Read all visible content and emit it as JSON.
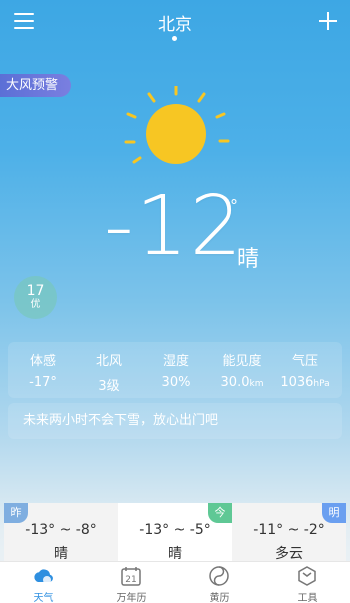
{
  "header": {
    "city": "北京"
  },
  "alert": {
    "label": "大风预警"
  },
  "current": {
    "temperature": "-12",
    "degree_symbol": "°",
    "condition": "晴",
    "aqi_value": "17",
    "aqi_level": "优"
  },
  "details": [
    {
      "label": "体感",
      "value": "-17°",
      "unit": ""
    },
    {
      "label": "北风",
      "value": "3级",
      "unit": ""
    },
    {
      "label": "湿度",
      "value": "30%",
      "unit": ""
    },
    {
      "label": "能见度",
      "value": "30.0",
      "unit": "km"
    },
    {
      "label": "气压",
      "value": "1036",
      "unit": "hPa"
    }
  ],
  "tip": "未来两小时不会下雪，放心出门吧",
  "days": [
    {
      "tag": "昨",
      "range": "-13° ~ -8°",
      "condition": "晴"
    },
    {
      "tag": "今",
      "range": "-13° ~ -5°",
      "condition": "晴"
    },
    {
      "tag": "明",
      "range": "-11° ~ -2°",
      "condition": "多云"
    }
  ],
  "nav": [
    {
      "label": "天气",
      "icon": "weather-icon",
      "active": true
    },
    {
      "label": "万年历",
      "icon": "calendar-icon",
      "calendar_day": "21",
      "active": false
    },
    {
      "label": "黄历",
      "icon": "almanac-icon",
      "active": false
    },
    {
      "label": "工具",
      "icon": "tools-icon",
      "active": false
    }
  ],
  "colors": {
    "accent": "#2e8fe0",
    "alert": "#5b6fd6",
    "sun": "#f7c623",
    "today_tag": "#5fc895"
  }
}
